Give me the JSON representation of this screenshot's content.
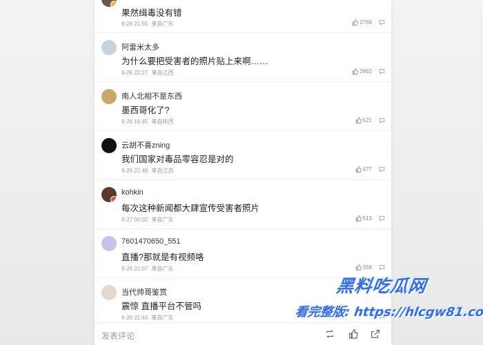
{
  "comments": [
    {
      "username": "",
      "text": "果然缉毒没有错",
      "time": "9-26 21:55",
      "location": "来自广东",
      "likes": "2769"
    },
    {
      "username": "阿雷米太多",
      "text": "为什么要把受害者的照片贴上来啊……",
      "time": "9-26 22:27",
      "location": "来自江西",
      "likes": "2862"
    },
    {
      "username": "南人北相不是东西",
      "text": "墨西哥化了?",
      "time": "9-26 16:45",
      "location": "来自陕西",
      "likes": "521"
    },
    {
      "username": "云胡不喜zning",
      "text": "我们国家对毒品零容忍是对的",
      "time": "9-26 22:48",
      "location": "来自江苏",
      "likes": "477"
    },
    {
      "username": "kohkin",
      "text": "每次这种新闻都大肆宣传受害者照片",
      "time": "9-27 00:02",
      "location": "来自广东",
      "likes": "513"
    },
    {
      "username": "7601470650_551",
      "text": "直播?那就是有视频咯",
      "time": "9-26 21:07",
      "location": "来自广东",
      "likes": "358"
    },
    {
      "username": "当代帅哥鉴赏",
      "text": "震惊 直播平台不管吗",
      "time": "9-26 21:44",
      "location": "来自广东",
      "likes": ""
    }
  ],
  "footer": {
    "placeholder": "发表评论"
  },
  "watermark": {
    "line1": "黑料吃瓜网",
    "line2": "看完整版: https://hlcgw81.com"
  },
  "colors": {
    "watermark": "#2f6df6",
    "text": "#222222",
    "meta": "#9a9a9a"
  }
}
